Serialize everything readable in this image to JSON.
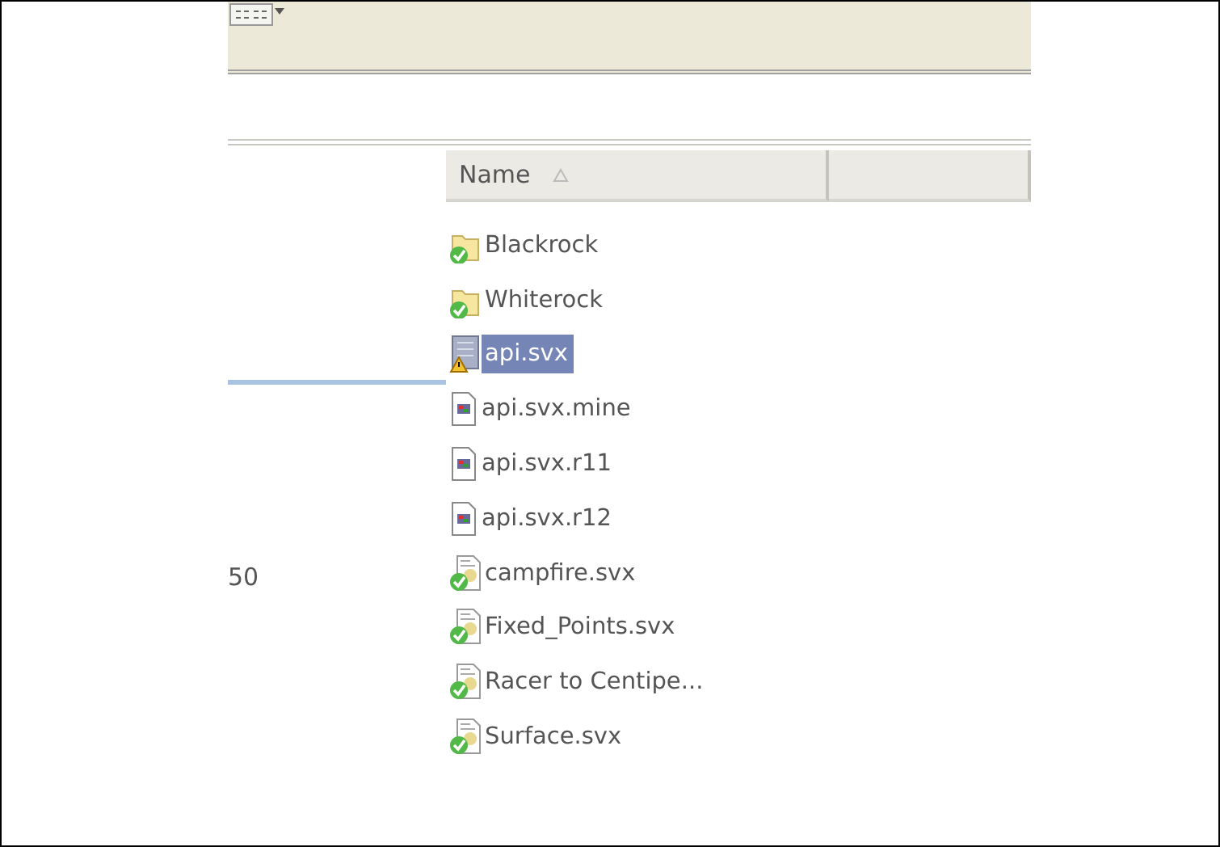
{
  "left_pane": {
    "value": "50"
  },
  "list": {
    "columns": [
      {
        "label": "Name",
        "sorted_ascending": true
      },
      {
        "sorted_ascending": false
      }
    ],
    "items": [
      {
        "name": "Blackrock",
        "kind": "folder-ok",
        "selected": false
      },
      {
        "name": "Whiterock",
        "kind": "folder-ok",
        "selected": false
      },
      {
        "name": "api.svx",
        "kind": "conflict",
        "selected": true
      },
      {
        "name": "api.svx.mine",
        "kind": "plain",
        "selected": false
      },
      {
        "name": "api.svx.r11",
        "kind": "plain",
        "selected": false
      },
      {
        "name": "api.svx.r12",
        "kind": "plain",
        "selected": false
      },
      {
        "name": "campfire.svx",
        "kind": "file-ok",
        "selected": false
      },
      {
        "name": "Fixed_Points.svx",
        "kind": "file-ok",
        "selected": false
      },
      {
        "name": "Racer to Centipe...",
        "kind": "file-ok",
        "selected": false
      },
      {
        "name": "Surface.svx",
        "kind": "file-ok",
        "selected": false
      }
    ]
  }
}
